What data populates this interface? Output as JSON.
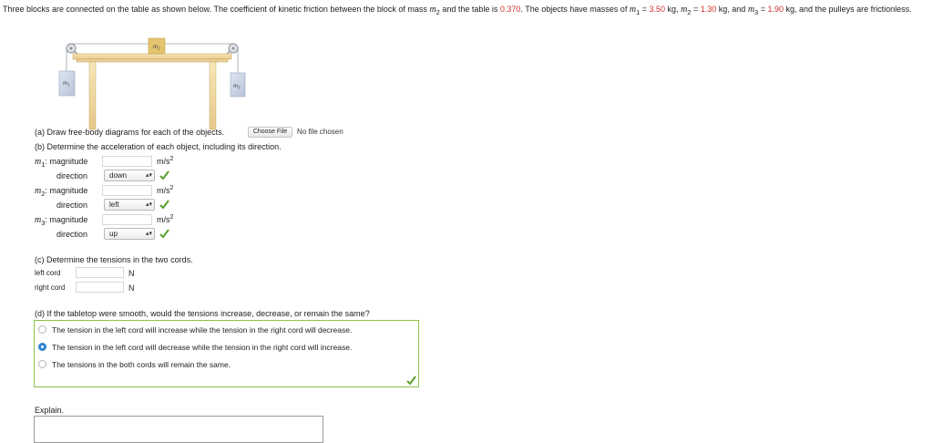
{
  "intro": {
    "text_before": "Three blocks are connected on the table as shown below. The coefficient of kinetic friction between the block of mass ",
    "m2_symbol": "m",
    "m2_sub": "2",
    "text_mid": " and the table is ",
    "mu_value": "0.370",
    "text_masses": ". The objects have masses of ",
    "m1_label": "m",
    "m1_sub": "1",
    "m1_value": "3.50",
    "m2_label": "m",
    "m2_sub2": "2",
    "m2_value": "1.30",
    "m3_label": "m",
    "m3_sub": "3",
    "m3_value": "1.90",
    "eq": " = ",
    "kg": " kg",
    "and": ", and ",
    "sep": ", ",
    "text_end": " kg, and the pulleys are frictionless."
  },
  "figure": {
    "m1_label": "m",
    "m1_sub": "1",
    "m2_label": "m",
    "m2_sub": "2",
    "m3_label": "m",
    "m3_sub": "3"
  },
  "part_a": {
    "label": "(a) Draw free-body diagrams for each of the objects.",
    "choose_file": "Choose File",
    "no_file": "No file chosen"
  },
  "part_b": {
    "label": "(b) Determine the acceleration of each object, including its direction.",
    "rows": [
      {
        "mass": "m",
        "sub": "1",
        "magnitude_label": ": magnitude",
        "unit": "m/s",
        "unit_exp": "2",
        "direction_label": "direction",
        "direction": "down"
      },
      {
        "mass": "m",
        "sub": "2",
        "magnitude_label": ": magnitude",
        "unit": "m/s",
        "unit_exp": "2",
        "direction_label": "direction",
        "direction": "left"
      },
      {
        "mass": "m",
        "sub": "3",
        "magnitude_label": ": magnitude",
        "unit": "m/s",
        "unit_exp": "2",
        "direction_label": "direction",
        "direction": "up"
      }
    ]
  },
  "part_c": {
    "label": "(c) Determine the tensions in the two cords.",
    "left_label": "left cord",
    "left_unit": "N",
    "right_label": "right cord",
    "right_unit": "N"
  },
  "part_d": {
    "label": "(d) If the tabletop were smooth, would the tensions increase, decrease, or remain the same?",
    "options": [
      "The tension in the left cord will increase while the tension in the right cord will decrease.",
      "The tension in the left cord will decrease while the tension in the right cord will increase.",
      "The tensions in the both cords will remain the same."
    ],
    "selected_index": 1
  },
  "explain": {
    "label": "Explain."
  },
  "colors": {
    "given_values": "#d0312d",
    "correct_check": "#5aa02c",
    "selected_radio": "#2f88d8",
    "answer_border": "#8bc34a"
  }
}
